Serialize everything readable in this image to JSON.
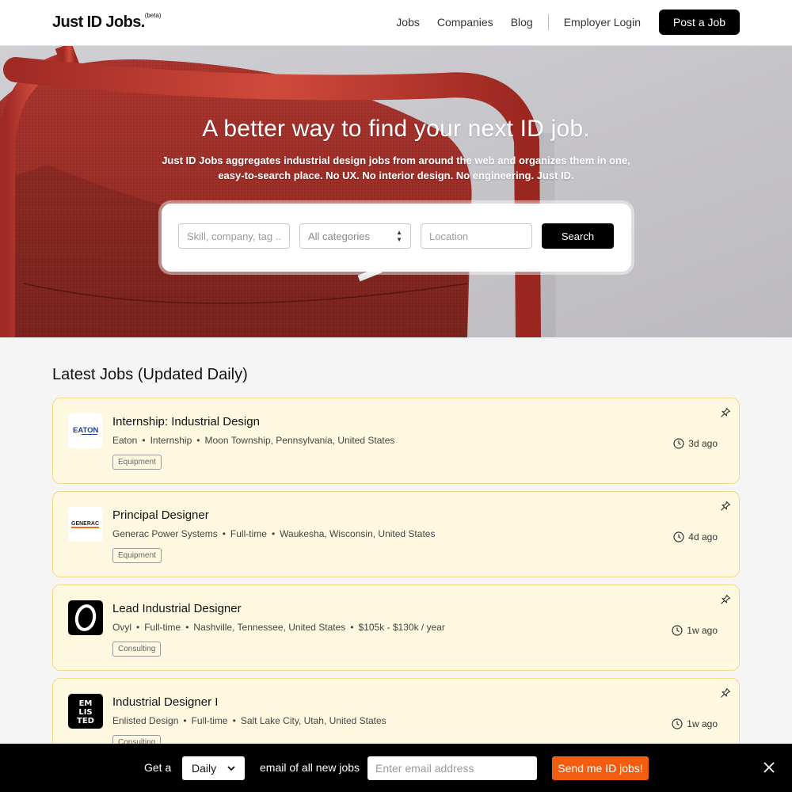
{
  "header": {
    "logo": "Just ID Jobs.",
    "logo_badge": "(beta)",
    "nav": [
      "Jobs",
      "Companies",
      "Blog"
    ],
    "employer_login": "Employer Login",
    "post_job": "Post a Job"
  },
  "hero": {
    "title": "A better way to find your next ID job.",
    "subtitle": "Just ID Jobs aggregates industrial design jobs from around the web and organizes them in one, easy-to-search place. No UX. No interior design. No engineering. Just ID.",
    "search": {
      "keyword_placeholder": "Skill, company, tag ..",
      "category_value": "All categories",
      "location_placeholder": "Location",
      "button": "Search"
    }
  },
  "jobs_section": {
    "title": "Latest Jobs (Updated Daily)",
    "jobs": [
      {
        "title": "Internship: Industrial Design",
        "company": "Eaton",
        "type": "Internship",
        "location": "Moon Township, Pennsylvania, United States",
        "salary": "",
        "tag": "Equipment",
        "posted": "3d ago",
        "logo_text": "EATON",
        "logo_icon": "eaton-logo-icon"
      },
      {
        "title": "Principal Designer",
        "company": "Generac Power Systems",
        "type": "Full-time",
        "location": "Waukesha, Wisconsin, United States",
        "salary": "",
        "tag": "Equipment",
        "posted": "4d ago",
        "logo_text": "GENERAC",
        "logo_icon": "generac-logo-icon"
      },
      {
        "title": "Lead Industrial Designer",
        "company": "Ovyl",
        "type": "Full-time",
        "location": "Nashville, Tennessee, United States",
        "salary": "$105k - $130k / year",
        "tag": "Consulting",
        "posted": "1w ago",
        "logo_text": "O",
        "logo_icon": "ovyl-logo-icon"
      },
      {
        "title": "Industrial Designer I",
        "company": "Enlisted Design",
        "type": "Full-time",
        "location": "Salt Lake City, Utah, United States",
        "salary": "",
        "tag": "Consulting",
        "posted": "1w ago",
        "logo_text": "EN LIS TED",
        "logo_icon": "enlisted-logo-icon"
      }
    ]
  },
  "subscribe_bar": {
    "prefix": "Get a",
    "frequency": "Daily",
    "suffix": "email of all new jobs",
    "email_placeholder": "Enter email address",
    "button": "Send me ID jobs!"
  },
  "colors": {
    "accent": "#f45d10",
    "card_bg": "#fff8e1",
    "card_border": "#f2d98a",
    "chair_red": "#b8332a"
  }
}
